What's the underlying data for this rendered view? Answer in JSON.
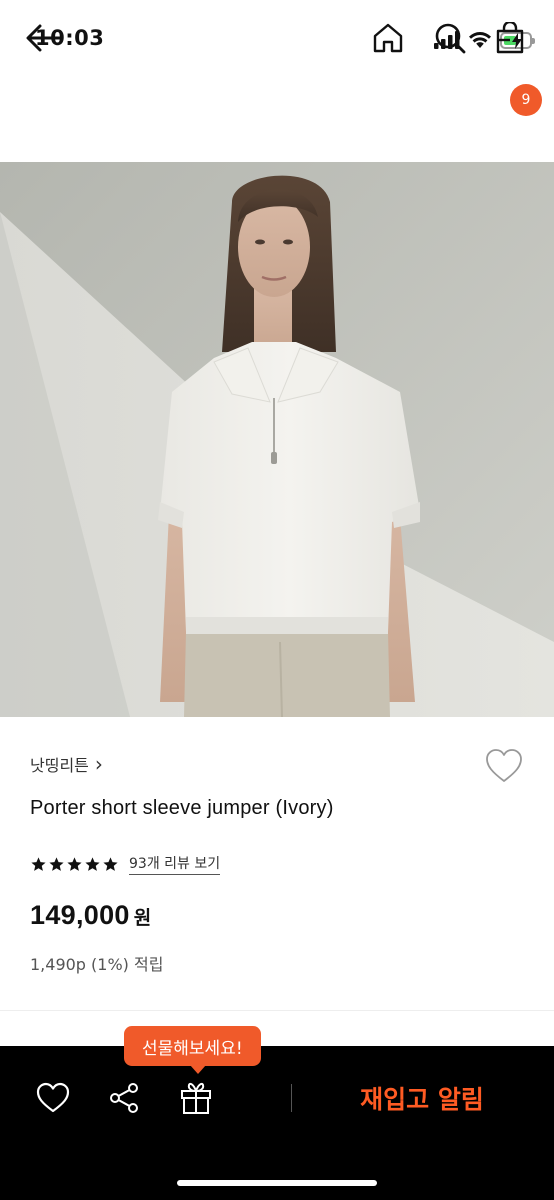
{
  "status_bar": {
    "time": "10:03",
    "battery_level": 0.5
  },
  "nav": {
    "cart_count": "9"
  },
  "product": {
    "brand": "낫띵리튼",
    "brand_chevron": "›",
    "name": "Porter short sleeve jumper (Ivory)",
    "rating": 5,
    "review_link": "93개 리뷰 보기",
    "price": "149,000",
    "price_unit": "원",
    "points": "1,490p (1%) 적립"
  },
  "bottom_bar": {
    "gift_tooltip": "선물해보세요!",
    "restock_label": "재입고 알림"
  },
  "colors": {
    "accent": "#f05a2a",
    "restock_text": "#ff5b23",
    "bottom_bar_bg": "#000000"
  },
  "icons": [
    "back-arrow-icon",
    "home-icon",
    "search-icon",
    "shopping-bag-icon",
    "heart-icon",
    "share-icon",
    "gift-icon",
    "star-icon"
  ]
}
